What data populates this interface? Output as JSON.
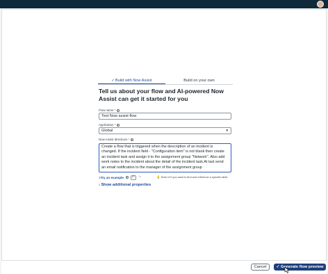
{
  "tabs": [
    {
      "label": "Build with Now Assist",
      "active": true
    },
    {
      "label": "Build on your own",
      "active": false
    }
  ],
  "tab_check_icon": "check-icon",
  "heading": "Tell us about your flow and AI-powered Now Assist can get it started for you",
  "flow_name": {
    "label": "Flow name",
    "value": "Test Now assist flow"
  },
  "application": {
    "label": "Application",
    "value": "Global"
  },
  "directions": {
    "label": "Now Assist directions",
    "value": "Create a flow that is triggered when the description of an incident is changed. If the incident field - \"Configuration item\" is not blank then create an incident task and assign it to the assignment group \"Network\". Also add work notes to the incident about the detail of the incident task.At last send an email notification to the manager of the assignment group"
  },
  "try_example": "Try an example",
  "hint": "Enter # if you want to find and reference a specific table",
  "show_additional": "Show additional properties",
  "cancel": "Cancel",
  "generate": "Generate flow preview",
  "required_mark": "*",
  "colors": {
    "accent": "#1f4d9c",
    "primary_button": "#1f3f7a",
    "topbar": "#0e2a3b"
  }
}
